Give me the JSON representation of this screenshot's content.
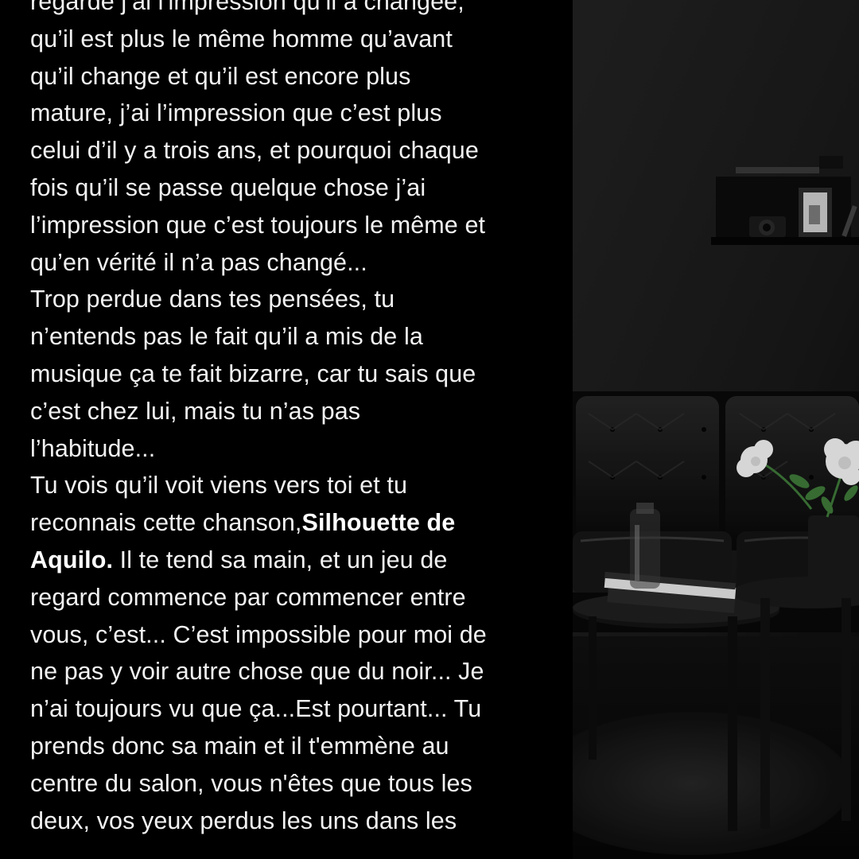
{
  "story": {
    "lines": [
      {
        "text": "regarde j’ai l'impression qu’il a changée,"
      },
      {
        "text": "qu’il est plus le même homme qu’avant"
      },
      {
        "text": "qu’il change et qu’il est encore plus"
      },
      {
        "text": "mature, j’ai l’impression que c’est plus"
      },
      {
        "text": "celui d’il y a trois ans, et pourquoi chaque"
      },
      {
        "text": "fois qu’il se passe quelque chose j’ai"
      },
      {
        "text": "l’impression que c’est toujours le même et"
      },
      {
        "text": "qu’en vérité il n’a pas changé..."
      },
      {
        "text": "Trop perdue dans tes pensées, tu"
      },
      {
        "text": "n’entends pas le fait qu’il a mis de la"
      },
      {
        "text": "musique ça te fait bizarre, car tu sais que"
      },
      {
        "text": "c’est chez lui, mais tu n’as pas"
      },
      {
        "text": "l’habitude..."
      },
      {
        "text": "Tu vois qu’il voit viens vers toi et tu"
      },
      {
        "pre": "reconnais cette chanson,",
        "bold": "Silhouette de"
      },
      {
        "bold": "Aquilo.",
        "post": " Il te tend sa main, et un jeu de"
      },
      {
        "text": "regard commence par commencer entre"
      },
      {
        "text": "vous, c’est... C’est impossible pour moi de"
      },
      {
        "text": "ne pas y voir autre chose que du noir... Je"
      },
      {
        "text": "n’ai toujours vu que ça...Est pourtant... Tu"
      },
      {
        "text": "prends donc sa main et il t'emmène au"
      },
      {
        "text": "centre du salon, vous n'êtes que tous les"
      },
      {
        "text": "deux, vos yeux perdus les uns dans les"
      }
    ]
  },
  "photo": {
    "subject": "dark living room with black leather sofa, wall shelf with camera and frame, white flowers, glass carafe and books on round black coffee table",
    "colors": {
      "wall": "#1c1c1c",
      "sofa": "#0d0d0d",
      "flowers": "#f4f4f4",
      "leaves": "#3f7a3a"
    }
  }
}
